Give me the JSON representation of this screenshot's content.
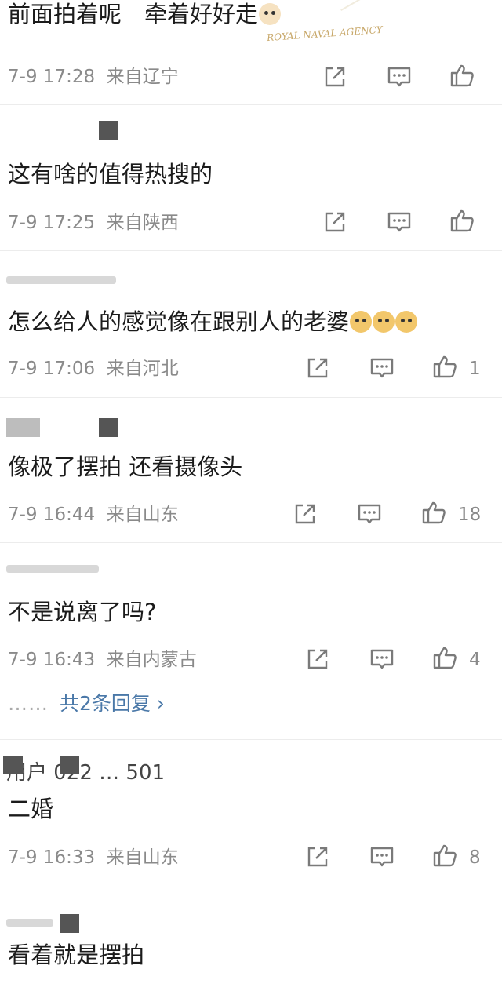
{
  "comments": [
    {
      "text": "前面拍着呢　牵着好好走",
      "time": "7-9 17:28",
      "location": "来自辽宁",
      "likes": "",
      "watermark": "ROYAL NAVAL AGENCY"
    },
    {
      "text": "这有啥的值得热搜的",
      "time": "7-9 17:25",
      "location": "来自陕西",
      "likes": ""
    },
    {
      "text": "怎么给人的感觉像在跟别人的老婆",
      "time": "7-9 17:06",
      "location": "来自河北",
      "likes": "1"
    },
    {
      "text": "像极了摆拍 还看摄像头",
      "time": "7-9 16:44",
      "location": "来自山东",
      "likes": "18"
    },
    {
      "text": "不是说离了吗?",
      "time": "7-9 16:43",
      "location": "来自内蒙古",
      "likes": "4",
      "replies_label": "共2条回复 ›",
      "replies_dots": "……"
    },
    {
      "username": "用户 022 … 501",
      "text": "二婚",
      "time": "7-9 16:33",
      "location": "来自山东",
      "likes": "8"
    },
    {
      "text": "看着就是摆拍",
      "time": "",
      "location": "",
      "likes": ""
    }
  ],
  "icons": {
    "share": "share-icon",
    "comment": "comment-icon",
    "like": "thumbs-up-icon"
  },
  "colors": {
    "meta": "#8a8a8a",
    "link": "#4a78a8",
    "divider": "#ececec"
  }
}
